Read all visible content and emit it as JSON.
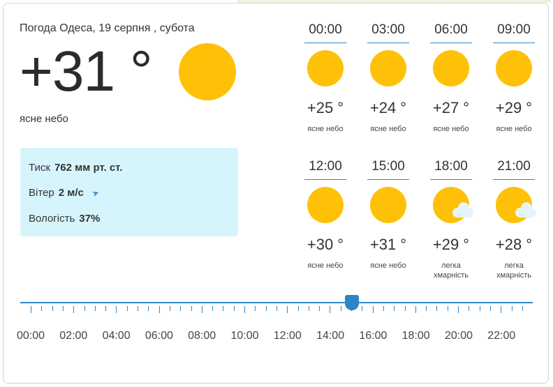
{
  "current": {
    "title": "Погода Одеса, 19 серпня , субота",
    "temp": "+31 °",
    "description": "ясне небо",
    "icon": "sun-icon"
  },
  "details": {
    "pressure_label": "Тиск",
    "pressure_value": "762 мм рт. ст.",
    "wind_label": "Вітер",
    "wind_value": "2 м/с",
    "humidity_label": "Вологість",
    "humidity_value": "37%"
  },
  "hourly": [
    {
      "time": "00:00",
      "temp": "+25 °",
      "cond": "ясне небо",
      "icon": "sun-icon"
    },
    {
      "time": "03:00",
      "temp": "+24 °",
      "cond": "ясне небо",
      "icon": "sun-icon"
    },
    {
      "time": "06:00",
      "temp": "+27 °",
      "cond": "ясне небо",
      "icon": "sun-icon"
    },
    {
      "time": "09:00",
      "temp": "+29 °",
      "cond": "ясне небо",
      "icon": "sun-icon"
    },
    {
      "time": "12:00",
      "temp": "+30 °",
      "cond": "ясне небо",
      "icon": "sun-icon"
    },
    {
      "time": "15:00",
      "temp": "+31 °",
      "cond": "ясне небо",
      "icon": "sun-icon"
    },
    {
      "time": "18:00",
      "temp": "+29 °",
      "cond": "легка хмарність",
      "icon": "sun-cloud-icon"
    },
    {
      "time": "21:00",
      "temp": "+28 °",
      "cond": "легка хмарність",
      "icon": "sun-cloud-icon"
    }
  ],
  "timeline": {
    "labels": [
      "00:00",
      "02:00",
      "04:00",
      "06:00",
      "08:00",
      "10:00",
      "12:00",
      "14:00",
      "16:00",
      "18:00",
      "20:00",
      "22:00"
    ],
    "selected": "15:00"
  },
  "colors": {
    "accent": "#2b86c6",
    "sun": "#ffc107",
    "panel": "#d6f4fb"
  }
}
